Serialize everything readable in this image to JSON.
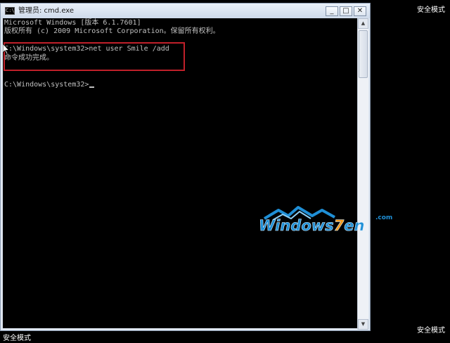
{
  "desktop": {
    "safe_mode_top_right": "安全模式",
    "safe_mode_bottom_right": "安全模式",
    "safe_mode_bottom_left": "安全模式"
  },
  "window": {
    "title": "管理员: cmd.exe",
    "icon_text": "C:\\",
    "controls": {
      "minimize": "_",
      "maximize": "□",
      "close": "✕"
    }
  },
  "console": {
    "lines": [
      "Microsoft Windows [版本 6.1.7601]",
      "版权所有 (c) 2009 Microsoft Corporation。保留所有权利。",
      "C:\\Windows\\system32>net user Smile /add",
      "命令成功完成。",
      "C:\\Windows\\system32>"
    ]
  },
  "watermark": {
    "brand": "Windows7en",
    "domain": ".com"
  },
  "colors": {
    "highlight_border": "#c0202a",
    "console_text": "#c0c0c0",
    "console_bg": "#000000",
    "logo_blue": "#1f8fd6",
    "logo_orange": "#f39a1e"
  },
  "icons": {
    "pointer": "mouse-pointer-icon",
    "scroll_up": "scroll-up-icon",
    "scroll_down": "scroll-down-icon"
  }
}
